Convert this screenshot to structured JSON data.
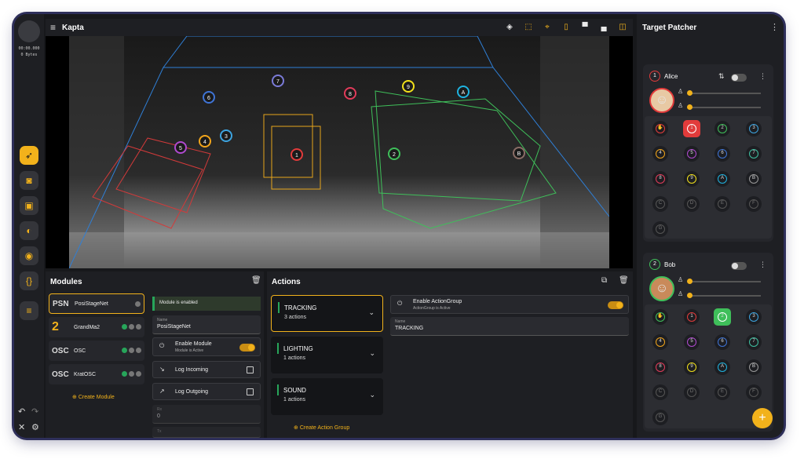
{
  "rail": {
    "time": "00:00.000",
    "bytes": "0 Bytes",
    "buttons": [
      "rocket-icon",
      "camera-icon",
      "bounding-box-icon",
      "play-circle-icon",
      "broadcast-icon",
      "braces-icon",
      "menu-icon"
    ],
    "bottom": [
      "undo-icon",
      "redo-icon",
      "crosshair-icon",
      "gear-icon"
    ]
  },
  "viewport": {
    "title": "Kapta",
    "tools": [
      "layers-icon",
      "transform-icon",
      "lasso-icon",
      "device-icon",
      "window-top-icon",
      "window-bottom-icon",
      "split-icon"
    ],
    "markers": [
      {
        "label": "7",
        "color": "#7b7bd8"
      },
      {
        "label": "9",
        "color": "#f2e11b"
      },
      {
        "label": "A",
        "color": "#1fb3e0"
      },
      {
        "label": "6",
        "color": "#3f74d6"
      },
      {
        "label": "8",
        "color": "#e23b5a"
      },
      {
        "label": "4",
        "color": "#f2a51b"
      },
      {
        "label": "3",
        "color": "#3da4e0"
      },
      {
        "label": "5",
        "color": "#b04ad0"
      },
      {
        "label": "1",
        "color": "#e23b3b"
      },
      {
        "label": "2",
        "color": "#3fbf5a"
      },
      {
        "label": "B",
        "color": "#8a6d66"
      }
    ]
  },
  "patcher": {
    "title": "Target Patcher",
    "targets": [
      {
        "index": "1",
        "name": "Alice",
        "color": "#e23b3b",
        "avatar": "woman-avatar-icon",
        "chips": [
          "✋",
          "1",
          "2",
          "3",
          "4",
          "5",
          "6",
          "7",
          "8",
          "9",
          "A",
          "B",
          "C",
          "D",
          "E",
          "F",
          "G"
        ],
        "selected": "1"
      },
      {
        "index": "2",
        "name": "Bob",
        "color": "#3fbf5a",
        "avatar": "man-avatar-icon",
        "chips": [
          "✋",
          "1",
          "2",
          "3",
          "4",
          "5",
          "6",
          "7",
          "8",
          "9",
          "A",
          "B",
          "C",
          "D",
          "E",
          "F",
          "G"
        ],
        "selected": "2"
      }
    ]
  },
  "modules": {
    "title": "Modules",
    "items": [
      {
        "logo": "PSN",
        "label": "PosiStageNet",
        "dots": [
          "grey"
        ]
      },
      {
        "logo": "2",
        "label": "GrandMa2",
        "dots": [
          "green",
          "grey",
          "grey"
        ]
      },
      {
        "logo": "OSC",
        "label": "OSC",
        "dots": [
          "green",
          "grey",
          "grey"
        ]
      },
      {
        "logo": "OSC",
        "label": "KratOSC",
        "dots": [
          "green",
          "grey",
          "grey"
        ]
      }
    ],
    "create": "Create Module",
    "status": "Module is enabled",
    "name_label": "Name",
    "name_value": "PosiStageNet",
    "enable_label": "Enable Module",
    "enable_sub": "Module is Active",
    "log_in": "Log Incoming",
    "log_out": "Log Outgoing",
    "rx_label": "Rx",
    "rx_value": "0",
    "tx_label": "Tx"
  },
  "actions": {
    "title": "Actions",
    "groups": [
      {
        "name": "TRACKING",
        "count": "3 actions"
      },
      {
        "name": "LIGHTING",
        "count": "1 actions"
      },
      {
        "name": "SOUND",
        "count": "1 actions"
      }
    ],
    "create": "Create Action Group",
    "enable_label": "Enable ActionGroup",
    "enable_sub": "ActionGroup is Active",
    "name_label": "Name",
    "name_value": "TRACKING"
  },
  "colors": {
    "accent": "#f2b21b",
    "success": "#27a55a"
  }
}
